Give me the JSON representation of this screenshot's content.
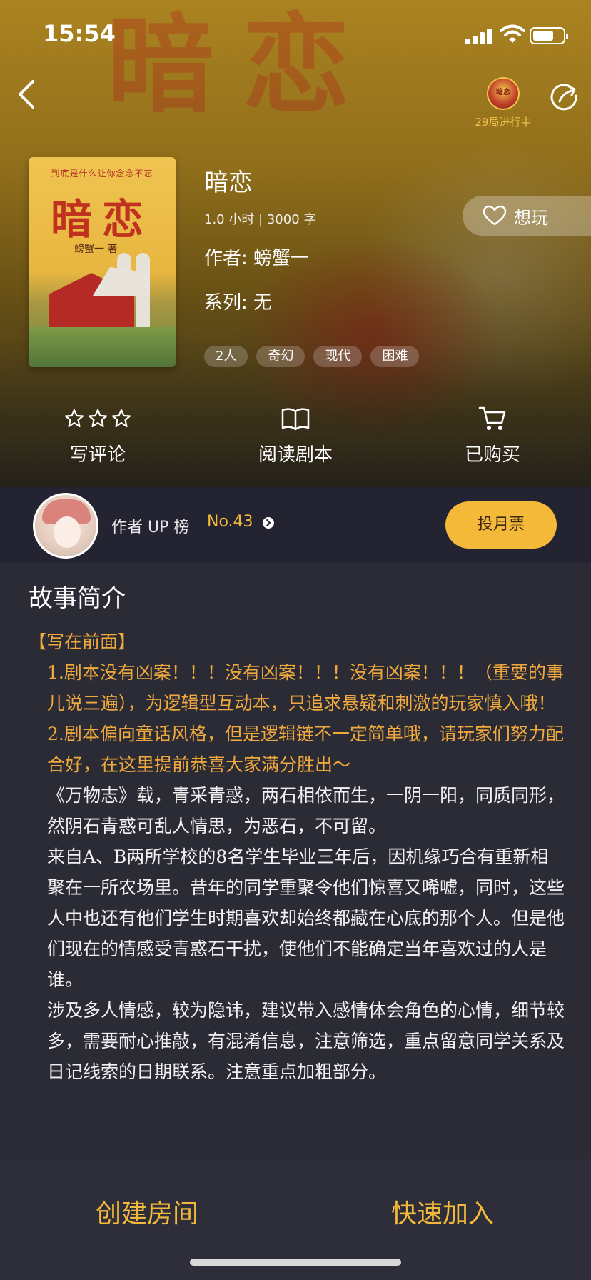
{
  "status_bar": {
    "time": "15:54"
  },
  "header": {
    "game_badge_text": "29局进行中",
    "badge_img_label": "暗恋",
    "background_title": "暗恋"
  },
  "cover": {
    "tagline": "到底是什么让你念念不忘",
    "title": "暗恋",
    "author": "螃蟹一 著"
  },
  "script_info": {
    "title": "暗恋",
    "duration": "1.0 小时 | 3000 字",
    "author": "作者: 螃蟹一",
    "series": "系列: 无",
    "tags": [
      "2人",
      "奇幻",
      "现代",
      "困难"
    ],
    "want_label": "想玩"
  },
  "actions": {
    "review": "写评论",
    "read": "阅读剧本",
    "purchased": "已购买"
  },
  "ranking": {
    "label": "作者 UP 榜",
    "rank": "No.43",
    "vote_button": "投月票"
  },
  "synopsis": {
    "heading": "故事简介",
    "p1": "【写在前面】",
    "p2": "1.剧本没有凶案！！！没有凶案！！！没有凶案！！！（重要的事儿说三遍），为逻辑型互动本，只追求悬疑和刺激的玩家慎入哦！",
    "p3": "2.剧本偏向童话风格，但是逻辑链不一定简单哦，请玩家们努力配合好，在这里提前恭喜大家满分胜出～",
    "p4": "《万物志》载，青采青惑，两石相依而生，一阴一阳，同质同形，然阴石青惑可乱人情思，为恶石，不可留。",
    "p5": "来自A、B两所学校的8名学生毕业三年后，因机缘巧合有重新相聚在一所农场里。昔年的同学重聚令他们惊喜又唏嘘，同时，这些人中也还有他们学生时期喜欢却始终都藏在心底的那个人。但是他们现在的情感受青惑石干扰，使他们不能确定当年喜欢过的人是谁。",
    "p6": "涉及多人情感，较为隐讳，建议带入感情体会角色的心情，细节较多，需要耐心推敲，有混淆信息，注意筛选，重点留意同学关系及日记线索的日期联系。注意重点加粗部分。"
  },
  "bottom": {
    "create_room": "创建房间",
    "quick_join": "快速加入"
  },
  "colors": {
    "accent": "#f2b93b",
    "orange_text": "#f0a93d",
    "dark_bg": "#2b2b36"
  },
  "icons": [
    "back-arrow-icon",
    "share-icon",
    "heart-icon",
    "star-icon",
    "book-icon",
    "cart-icon",
    "chevron-right-icon"
  ]
}
